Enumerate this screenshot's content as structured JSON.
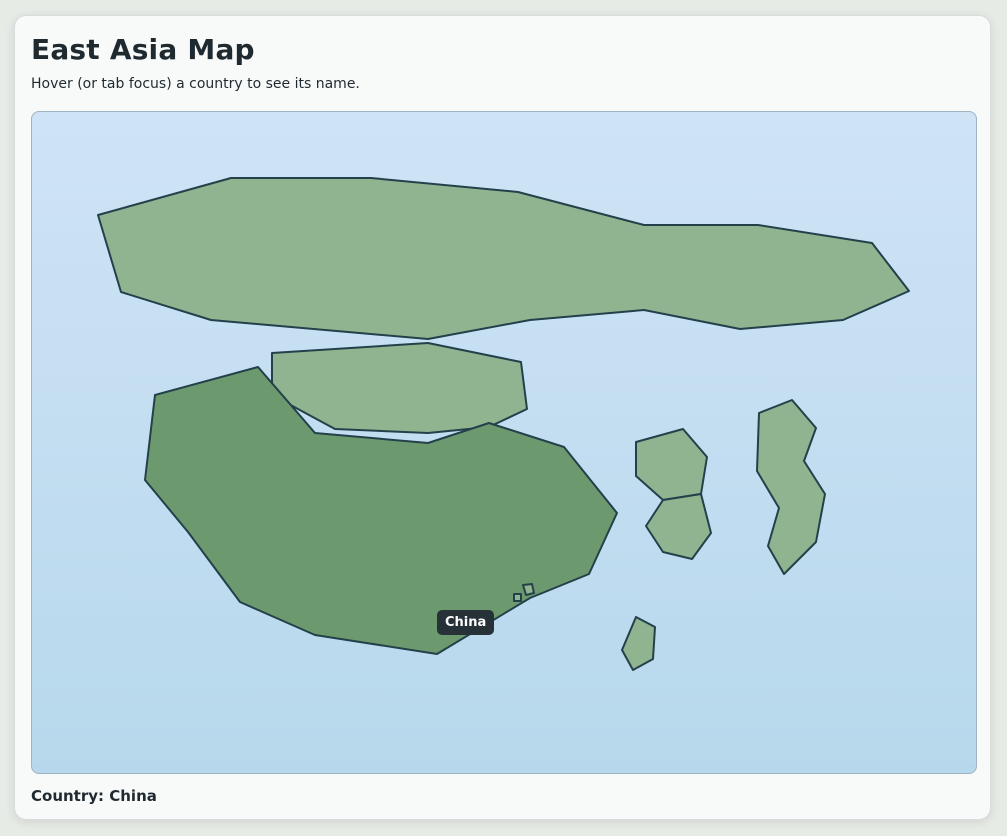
{
  "page": {
    "title": "East Asia Map",
    "subtitle": "Hover (or tab focus) a country to see its name."
  },
  "map": {
    "tooltip": "China",
    "hovered_country": "China",
    "ocean_color": "#c4dff2",
    "land_color": "#8fb48f",
    "active_land_color": "#6c9a6e",
    "border_color": "#24404a"
  },
  "status": {
    "label": "Country:",
    "value": "China"
  }
}
